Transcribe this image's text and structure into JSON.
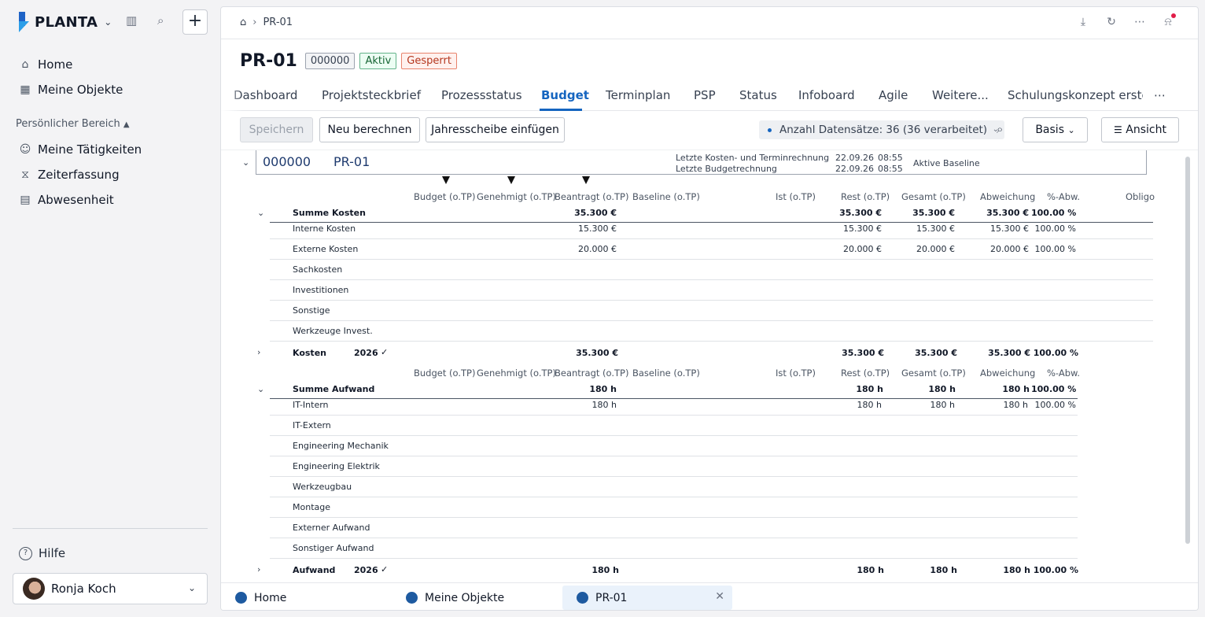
{
  "app": {
    "name": "PLANTA"
  },
  "sidebar": {
    "nav": [
      {
        "label": "Home"
      },
      {
        "label": "Meine Objekte"
      }
    ],
    "section_title": "Persönlicher Bereich",
    "personal": [
      {
        "label": "Meine Tätigkeiten"
      },
      {
        "label": "Zeiterfassung"
      },
      {
        "label": "Abwesenheit"
      }
    ],
    "help": "Hilfe",
    "user": "Ronja Koch"
  },
  "breadcrumb": {
    "current": "PR-01"
  },
  "project": {
    "title": "PR-01",
    "code": "000000",
    "status": "Aktiv",
    "lock": "Gesperrt"
  },
  "tabs": [
    "Dashboard",
    "Projektsteckbrief",
    "Prozessstatus",
    "Budget",
    "Terminplan",
    "PSP",
    "Status",
    "Infoboard",
    "Agile",
    "Weitere...",
    "Schulungskonzept erstel"
  ],
  "toolbar": {
    "save": "Speichern",
    "recalc": "Neu berechnen",
    "insert_year": "Jahresscheibe einfügen",
    "records": "Anzahl Datensätze: 36 (36 verarbeitet)",
    "basis": "Basis",
    "view": "Ansicht"
  },
  "header_box": {
    "code": "000000",
    "name": "PR-01",
    "last_cost_label": "Letzte Kosten- und Terminrechnung",
    "last_cost_date": "22.09.26",
    "last_cost_time": "08:55",
    "last_budget_label": "Letzte Budgetrechnung",
    "last_budget_date": "22.09.26",
    "last_budget_time": "08:55",
    "baseline": "Aktive Baseline"
  },
  "columns": [
    "Budget (o.TP)",
    "Genehmigt (o.TP)",
    "Beantragt (o.TP)",
    "Baseline (o.TP)",
    "Ist (o.TP)",
    "Rest (o.TP)",
    "Gesamt (o.TP)",
    "Abweichung",
    "%-Abw.",
    "Obligo"
  ],
  "costs": {
    "sum": {
      "label": "Summe Kosten",
      "beantragt": "35.300 €",
      "rest": "35.300 €",
      "gesamt": "35.300 €",
      "abw": "35.300 €",
      "pct": "100.00 %"
    },
    "rows": [
      {
        "label": "Interne Kosten",
        "beantragt": "15.300 €",
        "rest": "15.300 €",
        "gesamt": "15.300 €",
        "abw": "15.300 €",
        "pct": "100.00 %"
      },
      {
        "label": "Externe Kosten",
        "beantragt": "20.000 €",
        "rest": "20.000 €",
        "gesamt": "20.000 €",
        "abw": "20.000 €",
        "pct": "100.00 %"
      },
      {
        "label": "Sachkosten"
      },
      {
        "label": "Investitionen"
      },
      {
        "label": "Sonstige"
      },
      {
        "label": "Werkzeuge Invest."
      }
    ],
    "year": {
      "label": "Kosten",
      "year": "2026",
      "beantragt": "35.300 €",
      "rest": "35.300 €",
      "gesamt": "35.300 €",
      "abw": "35.300 €",
      "pct": "100.00 %"
    }
  },
  "effort": {
    "sum": {
      "label": "Summe Aufwand",
      "beantragt": "180 h",
      "rest": "180 h",
      "gesamt": "180 h",
      "abw": "180 h",
      "pct": "100.00 %"
    },
    "rows": [
      {
        "label": "IT-Intern",
        "beantragt": "180 h",
        "rest": "180 h",
        "gesamt": "180 h",
        "abw": "180 h",
        "pct": "100.00 %"
      },
      {
        "label": "IT-Extern"
      },
      {
        "label": "Engineering Mechanik"
      },
      {
        "label": "Engineering Elektrik"
      },
      {
        "label": "Werkzeugbau"
      },
      {
        "label": "Montage"
      },
      {
        "label": "Externer Aufwand"
      },
      {
        "label": "Sonstiger Aufwand"
      }
    ],
    "year": {
      "label": "Aufwand",
      "year": "2026",
      "beantragt": "180 h",
      "rest": "180 h",
      "gesamt": "180 h",
      "abw": "180 h",
      "pct": "100.00 %"
    }
  },
  "bottom_tabs": [
    {
      "label": "Home"
    },
    {
      "label": "Meine Objekte"
    },
    {
      "label": "PR-01"
    }
  ]
}
